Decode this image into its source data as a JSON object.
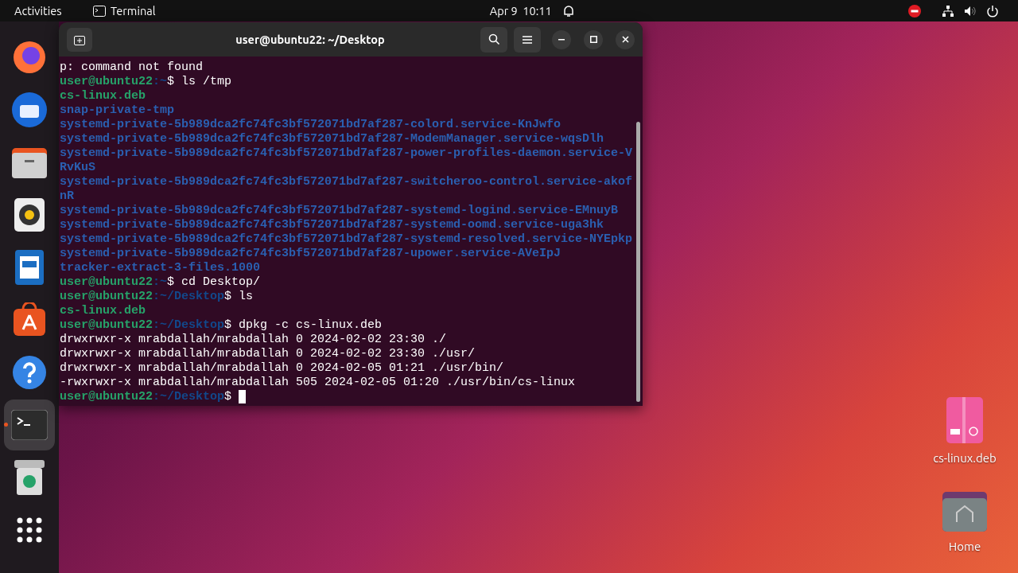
{
  "top_bar": {
    "activities": "Activities",
    "app_name": "Terminal",
    "clock": "Apr 9  10:11"
  },
  "dock": {
    "items": [
      {
        "kind": "firefox",
        "active": false
      },
      {
        "kind": "thunderbird",
        "active": false
      },
      {
        "kind": "files",
        "active": false
      },
      {
        "kind": "rhythmbox",
        "active": false
      },
      {
        "kind": "writer",
        "active": false
      },
      {
        "kind": "appcenter",
        "active": false
      },
      {
        "kind": "help",
        "active": false
      },
      {
        "kind": "terminal",
        "active": true
      },
      {
        "kind": "trash",
        "active": false
      },
      {
        "kind": "apps",
        "active": false
      }
    ]
  },
  "terminal": {
    "title": "user@ubuntu22: ~/Desktop",
    "lines": [
      {
        "kind": "text",
        "text": "p: command not found"
      },
      {
        "kind": "prompt",
        "user": "user@ubuntu22",
        "path": ":~",
        "command": "$ ls /tmp"
      },
      {
        "kind": "archive",
        "text": "cs-linux.deb"
      },
      {
        "kind": "directory",
        "text": "snap-private-tmp"
      },
      {
        "kind": "directory",
        "text": "systemd-private-5b989dca2fc74fc3bf572071bd7af287-colord.service-KnJwfo"
      },
      {
        "kind": "directory",
        "text": "systemd-private-5b989dca2fc74fc3bf572071bd7af287-ModemManager.service-wqsDlh"
      },
      {
        "kind": "directory",
        "text": "systemd-private-5b989dca2fc74fc3bf572071bd7af287-power-profiles-daemon.service-V"
      },
      {
        "kind": "directory",
        "text": "RvKuS"
      },
      {
        "kind": "directory",
        "text": "systemd-private-5b989dca2fc74fc3bf572071bd7af287-switcheroo-control.service-akof"
      },
      {
        "kind": "directory",
        "text": "nR"
      },
      {
        "kind": "directory",
        "text": "systemd-private-5b989dca2fc74fc3bf572071bd7af287-systemd-logind.service-EMnuyB"
      },
      {
        "kind": "directory",
        "text": "systemd-private-5b989dca2fc74fc3bf572071bd7af287-systemd-oomd.service-uga3hk"
      },
      {
        "kind": "directory",
        "text": "systemd-private-5b989dca2fc74fc3bf572071bd7af287-systemd-resolved.service-NYEpkp"
      },
      {
        "kind": "directory",
        "text": "systemd-private-5b989dca2fc74fc3bf572071bd7af287-upower.service-AVeIpJ"
      },
      {
        "kind": "directory",
        "text": "tracker-extract-3-files.1000"
      },
      {
        "kind": "prompt",
        "user": "user@ubuntu22",
        "path": ":~",
        "command": "$ cd Desktop/"
      },
      {
        "kind": "prompt",
        "user": "user@ubuntu22",
        "path": ":~/Desktop",
        "command": "$ ls"
      },
      {
        "kind": "archive",
        "text": "cs-linux.deb"
      },
      {
        "kind": "prompt",
        "user": "user@ubuntu22",
        "path": ":~/Desktop",
        "command": "$ dpkg -c cs-linux.deb"
      },
      {
        "kind": "text",
        "text": "drwxrwxr-x mrabdallah/mrabdallah 0 2024-02-02 23:30 ./"
      },
      {
        "kind": "text",
        "text": "drwxrwxr-x mrabdallah/mrabdallah 0 2024-02-02 23:30 ./usr/"
      },
      {
        "kind": "text",
        "text": "drwxrwxr-x mrabdallah/mrabdallah 0 2024-02-05 01:21 ./usr/bin/"
      },
      {
        "kind": "text",
        "text": "-rwxrwxr-x mrabdallah/mrabdallah 505 2024-02-05 01:20 ./usr/bin/cs-linux"
      },
      {
        "kind": "prompt",
        "user": "user@ubuntu22",
        "path": ":~/Desktop",
        "command": "$",
        "cursor": true
      }
    ]
  },
  "desktop_icons": [
    {
      "kind": "deb",
      "label": "cs-linux.deb"
    },
    {
      "kind": "home",
      "label": "Home"
    }
  ]
}
